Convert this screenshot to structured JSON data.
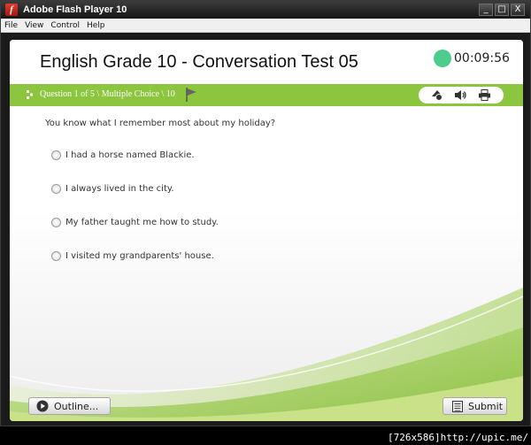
{
  "window": {
    "title": "Adobe Flash Player 10",
    "controls": [
      "_",
      "□",
      "X"
    ]
  },
  "menu": [
    "File",
    "View",
    "Control",
    "Help"
  ],
  "quiz": {
    "title": "English Grade 10 - Conversation Test 05",
    "timer": "00:09:56",
    "timer_color": "#4ecc8d",
    "accent_color": "#8cc63f",
    "question_info": "Question 1 of 5 \\ Multiple Choice \\ 10",
    "question": "You know what I remember most about my holiday?",
    "choices": [
      "I had a horse named Blackie.",
      "I always lived in the city.",
      "My father taught me how to study.",
      "I visited my grandparents' house."
    ],
    "tools": [
      "accessibility-icon",
      "speaker-icon",
      "printer-icon"
    ],
    "outline_label": "Outline...",
    "submit_label": "Submit"
  },
  "watermark": "[726x586]http://upic.me/"
}
